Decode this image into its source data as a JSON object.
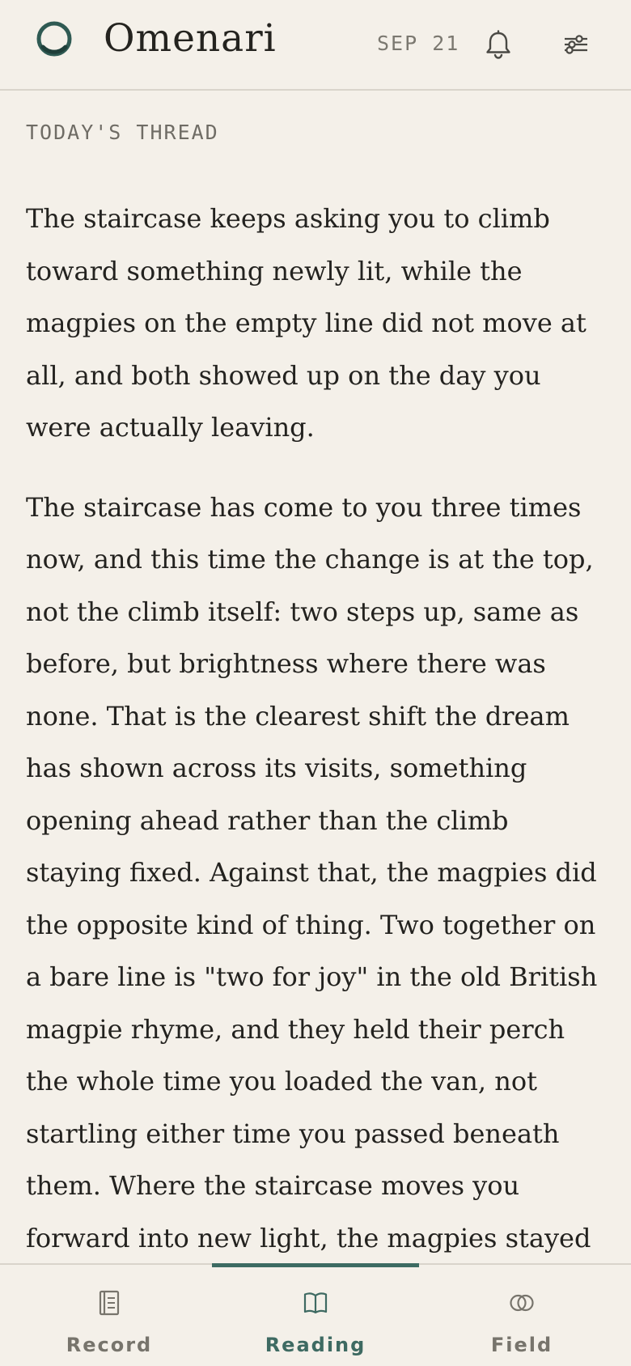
{
  "app": {
    "name": "Omenari",
    "date": "SEP 21"
  },
  "colors": {
    "background": "#f4f0e9",
    "accent": "#3d6b62",
    "text": "#23221f",
    "muted": "#77746c"
  },
  "header": {
    "logo_icon": "ring-logo-icon",
    "notifications_icon": "bell-icon",
    "filters_icon": "sliders-icon"
  },
  "thread": {
    "label": "TODAY'S THREAD",
    "paragraphs": [
      "The staircase keeps asking you to climb toward something newly lit, while the magpies on the empty line did not move at all, and both showed up on the day you were actually leaving.",
      "The staircase has come to you three times now, and this time the change is at the top, not the climb itself: two steps up, same as before, but brightness where there was none. That is the clearest shift the dream has shown across its visits, something opening ahead rather than the climb staying fixed. Against that, the magpies did the opposite kind of thing. Two together on a bare line is \"two for joy\" in the old British magpie rhyme, and they held their perch the whole time you loaded the van, not startling either time you passed beneath them. Where the staircase moves you forward into new light, the magpies stayed exactly still, watching"
    ]
  },
  "tabs": [
    {
      "label": "Record",
      "icon": "journal-icon",
      "active": false
    },
    {
      "label": "Reading",
      "icon": "open-book-icon",
      "active": true
    },
    {
      "label": "Field",
      "icon": "interlocking-circles-icon",
      "active": false
    }
  ]
}
